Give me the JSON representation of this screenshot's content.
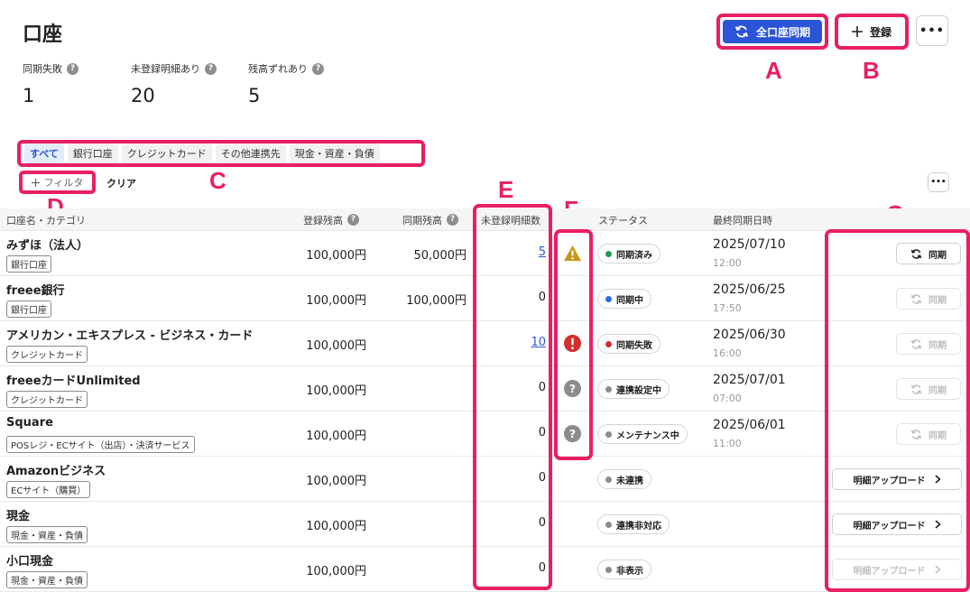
{
  "page": {
    "title": "口座"
  },
  "stats": [
    {
      "label": "同期失敗",
      "value": "1"
    },
    {
      "label": "未登録明細あり",
      "value": "20"
    },
    {
      "label": "残高ずれあり",
      "value": "5"
    }
  ],
  "toolbar": {
    "sync_all_label": "全口座同期",
    "register_label": "登録",
    "more_label": "•••"
  },
  "annotations": {
    "a": "A",
    "b": "B",
    "c": "C",
    "d": "D",
    "e": "E",
    "f": "F",
    "g": "G"
  },
  "tabs": [
    "すべて",
    "銀行口座",
    "クレジットカード",
    "その他連携先",
    "現金・資産・負債"
  ],
  "filter": {
    "filter_label": "フィルタ",
    "clear_label": "クリア",
    "more_label": "•••"
  },
  "columns": {
    "name": "口座名・カテゴリ",
    "registered_balance": "登録残高",
    "synced_balance": "同期残高",
    "unregistered_count": "未登録明細数",
    "status": "ステータス",
    "last_sync": "最終同期日時"
  },
  "rows": [
    {
      "name": "みずほ（法人）",
      "category": "銀行口座",
      "registered": "100,000円",
      "synced": "50,000円",
      "unregistered": "5",
      "status": "同期済み",
      "status_color": "#1f9d55",
      "date": "2025/07/10",
      "time": "12:00",
      "action": "同期"
    },
    {
      "name": "freee銀行",
      "category": "銀行口座",
      "registered": "100,000円",
      "synced": "100,000円",
      "unregistered": "0",
      "status": "同期中",
      "status_color": "#2b6fe0",
      "date": "2025/06/25",
      "time": "17:50",
      "action": "同期"
    },
    {
      "name": "アメリカン・エキスプレス - ビジネス・カード",
      "category": "クレジットカード",
      "registered": "100,000円",
      "synced": "",
      "unregistered": "10",
      "status": "同期失敗",
      "status_color": "#d32f2f",
      "date": "2025/06/30",
      "time": "16:00",
      "action": "同期"
    },
    {
      "name": "freeeカードUnlimited",
      "category": "クレジットカード",
      "registered": "100,000円",
      "synced": "",
      "unregistered": "0",
      "status": "連携設定中",
      "status_color": "#8c8c8c",
      "date": "2025/07/01",
      "time": "07:00",
      "action": "同期"
    },
    {
      "name": "Square",
      "category": "POSレジ・ECサイト（出店）・決済サービス",
      "registered": "100,000円",
      "synced": "",
      "unregistered": "0",
      "status": "メンテナンス中",
      "status_color": "#8c8c8c",
      "date": "2025/06/01",
      "time": "11:00",
      "action": "同期"
    },
    {
      "name": "Amazonビジネス",
      "category": "ECサイト（購買）",
      "registered": "100,000円",
      "synced": "",
      "unregistered": "0",
      "status": "未連携",
      "status_color": "#8c8c8c",
      "date": "",
      "time": "",
      "action": "明細アップロード"
    },
    {
      "name": "現金",
      "category": "現金・資産・負債",
      "registered": "100,000円",
      "synced": "",
      "unregistered": "0",
      "status": "連携非対応",
      "status_color": "#8c8c8c",
      "date": "",
      "time": "",
      "action": "明細アップロード"
    },
    {
      "name": "小口現金",
      "category": "現金・資産・負債",
      "registered": "100,000円",
      "synced": "",
      "unregistered": "0",
      "status": "非表示",
      "status_color": "#8c8c8c",
      "date": "",
      "time": "",
      "action": "明細アップロード"
    }
  ],
  "colors": {
    "accent": "#2b55d6",
    "annotation": "#e91e63",
    "warning": "#c9961a",
    "error": "#d32f2f",
    "neutral_icon": "#8c8c8c"
  }
}
